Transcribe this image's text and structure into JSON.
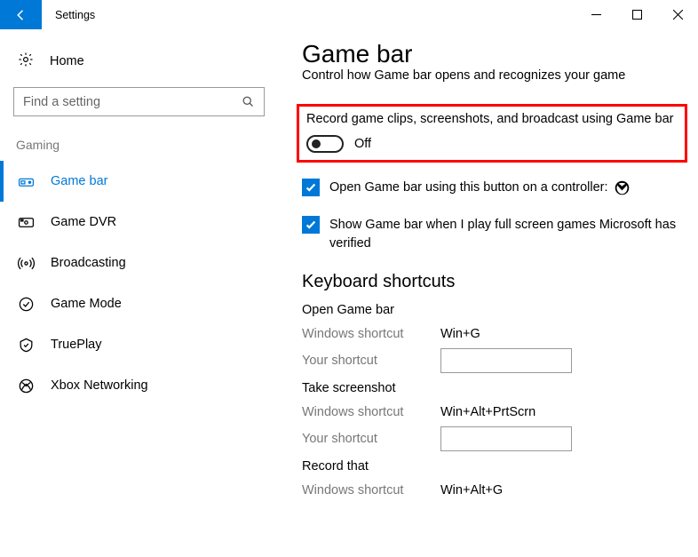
{
  "window": {
    "title": "Settings"
  },
  "sidebar": {
    "home_label": "Home",
    "search_placeholder": "Find a setting",
    "section_label": "Gaming",
    "items": [
      {
        "label": "Game bar"
      },
      {
        "label": "Game DVR"
      },
      {
        "label": "Broadcasting"
      },
      {
        "label": "Game Mode"
      },
      {
        "label": "TruePlay"
      },
      {
        "label": "Xbox Networking"
      }
    ]
  },
  "main": {
    "title": "Game bar",
    "subtitle": "Control how Game bar opens and recognizes your game",
    "record_toggle": {
      "label": "Record game clips, screenshots, and broadcast using Game bar",
      "state": "Off"
    },
    "checks": [
      {
        "label": "Open Game bar using this button on a controller:"
      },
      {
        "label": "Show Game bar when I play full screen games Microsoft has verified"
      }
    ],
    "shortcuts_heading": "Keyboard shortcuts",
    "windows_shortcut_label": "Windows shortcut",
    "your_shortcut_label": "Your shortcut",
    "shortcuts": [
      {
        "title": "Open Game bar",
        "win": "Win+G"
      },
      {
        "title": "Take screenshot",
        "win": "Win+Alt+PrtScrn"
      },
      {
        "title": "Record that",
        "win": "Win+Alt+G"
      }
    ]
  }
}
